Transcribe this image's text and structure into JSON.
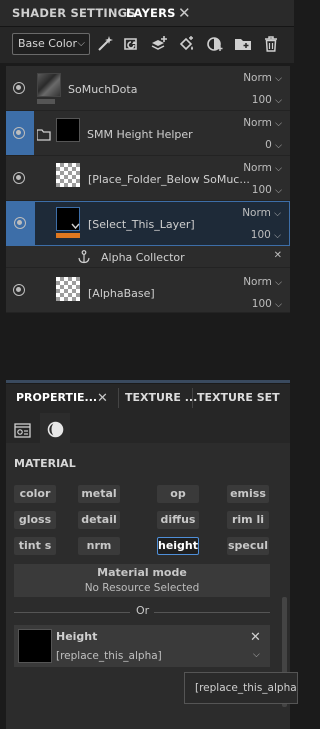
{
  "tabs": {
    "shader_settings": "SHADER SETTINGS",
    "layers": "LAYERS",
    "close": "✕"
  },
  "toolbar": {
    "channel_dropdown": "Base Color",
    "caret": "⌵"
  },
  "layers": [
    {
      "name": "SoMuchDota",
      "blend": "Norm",
      "opacity": "100"
    },
    {
      "name": "SMM Height Helper",
      "blend": "Norm",
      "opacity": "0"
    },
    {
      "name": "[Place_Folder_Below SoMuc...",
      "blend": "Norm",
      "opacity": "100"
    },
    {
      "name": "[Select_This_Layer]",
      "blend": "Norm",
      "opacity": "100"
    },
    {
      "name": "Alpha Collector",
      "blend": "",
      "opacity": ""
    },
    {
      "name": "[AlphaBase]",
      "blend": "Norm",
      "opacity": "100"
    }
  ],
  "props_tabs": {
    "properties": "PROPERTIE...",
    "texture": "TEXTURE ...",
    "texture_set": "TEXTURE SET S..."
  },
  "material": {
    "heading": "MATERIAL",
    "channels": [
      "color",
      "metal",
      "op",
      "emiss",
      "gloss",
      "detail",
      "diffus",
      "rim li",
      "tint s",
      "nrm",
      "height",
      "specul"
    ],
    "selected": "height",
    "mode_label": "Material mode",
    "mode_value": "No Resource Selected",
    "or_label": "Or",
    "height_title": "Height",
    "height_value": "[replace_this_alpha]",
    "tooltip": "[replace_this_alpha"
  },
  "colors": {
    "selection_blue": "#3d6ea8",
    "accent_orange": "#e07820",
    "bg": "#2c2c2c"
  }
}
